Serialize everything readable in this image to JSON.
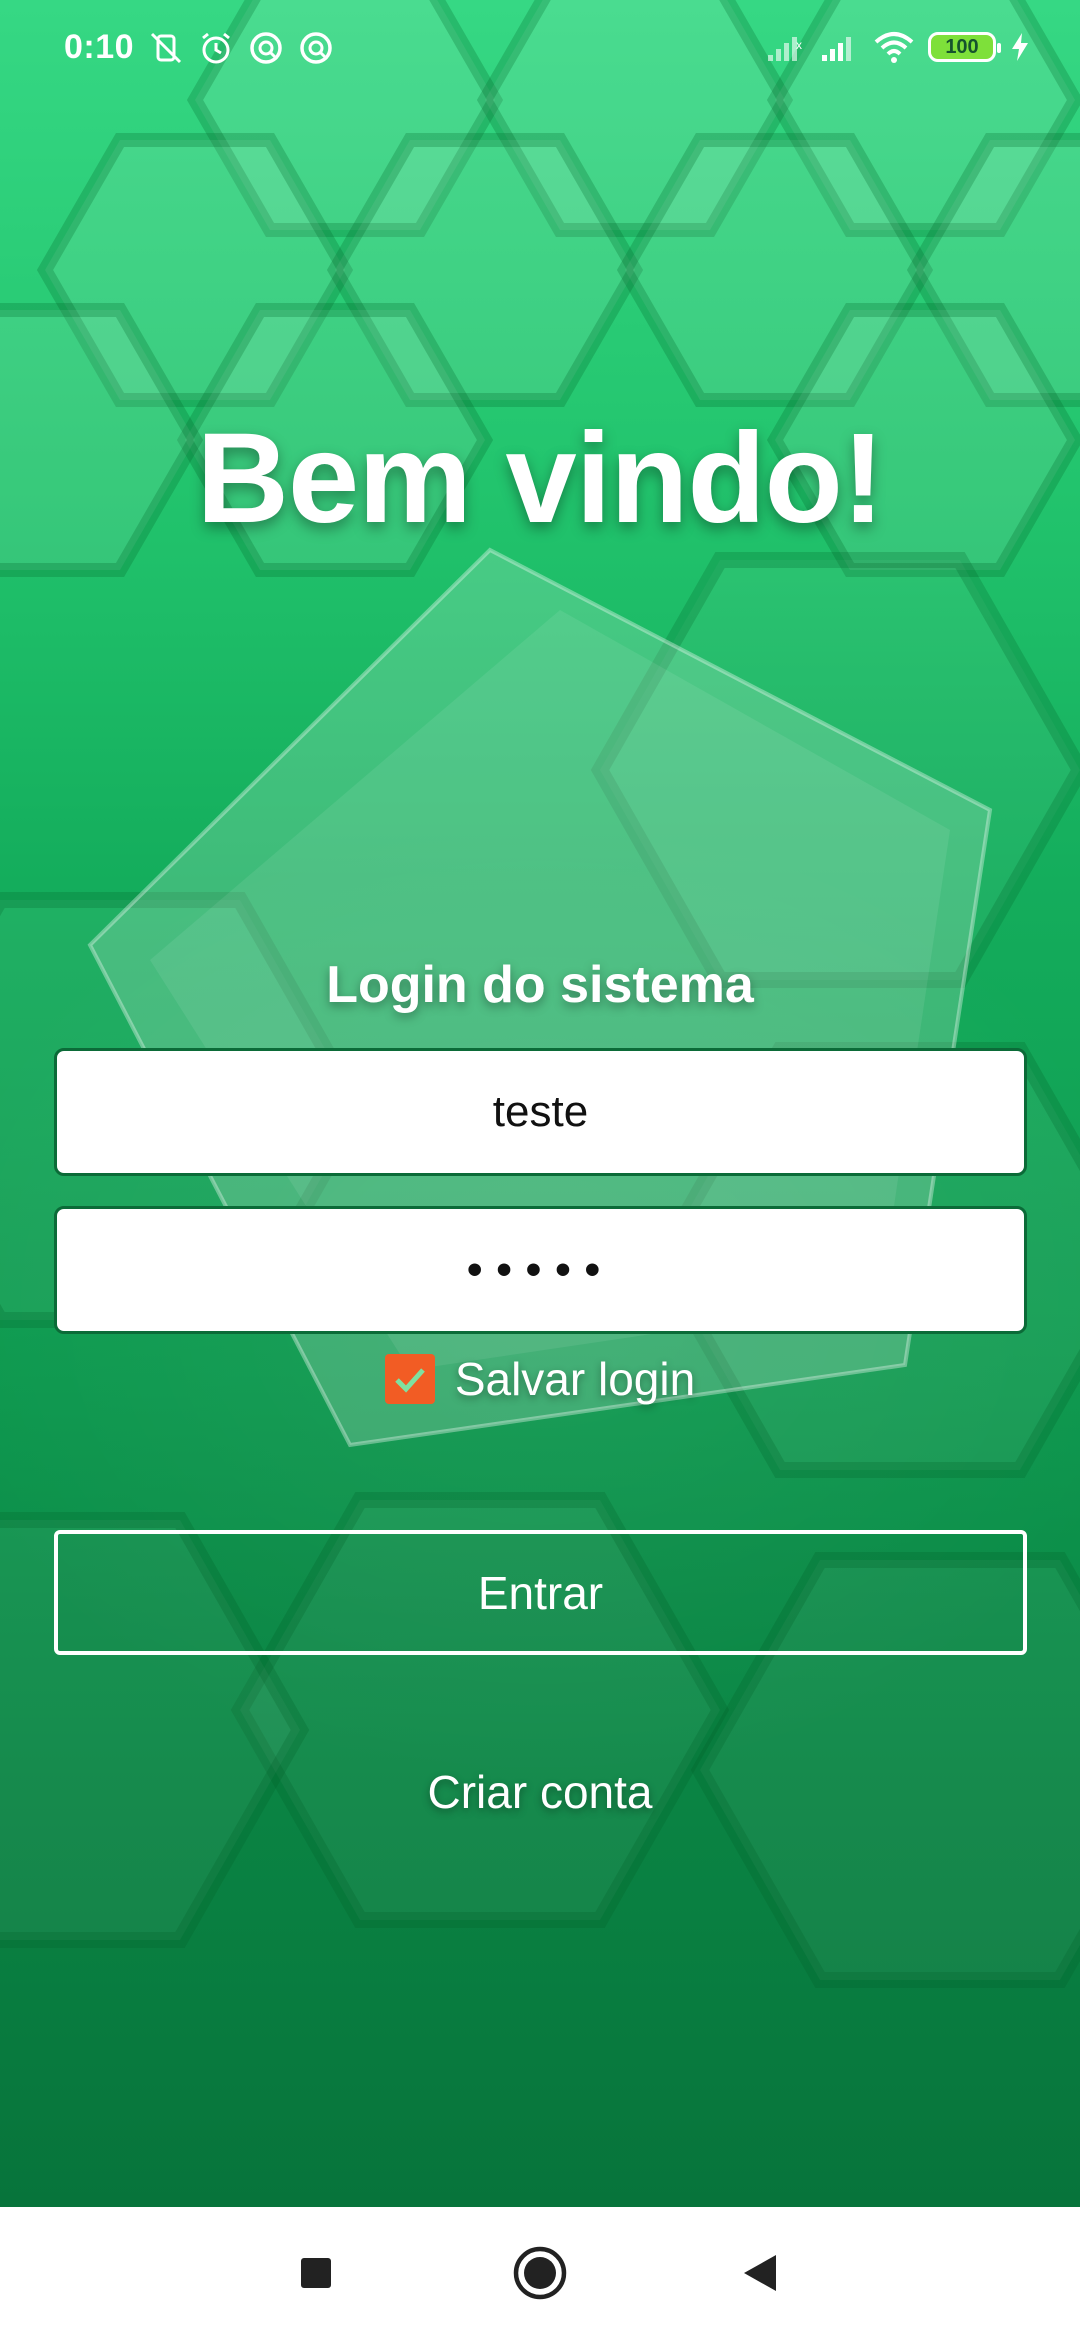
{
  "status_bar": {
    "time": "0:10",
    "left_icons": [
      "vibrate-off-icon",
      "alarm-icon",
      "app-notification-icon",
      "app-notification-icon"
    ],
    "right_icons": [
      "no-signal-icon",
      "signal-icon",
      "wifi-icon"
    ],
    "battery": "100"
  },
  "title": "Bem vindo!",
  "login": {
    "heading": "Login do sistema",
    "username_value": "teste",
    "password_value": "•••••",
    "save_login_label": "Salvar login",
    "save_login_checked": true,
    "enter_label": "Entrar",
    "create_account_label": "Criar conta"
  },
  "colors": {
    "background_green": "#14ad5c",
    "checkbox_orange": "#f25c24",
    "field_border": "#0b6b38"
  },
  "nav_bar": {
    "icons": [
      "recents-icon",
      "home-icon",
      "back-icon"
    ]
  }
}
